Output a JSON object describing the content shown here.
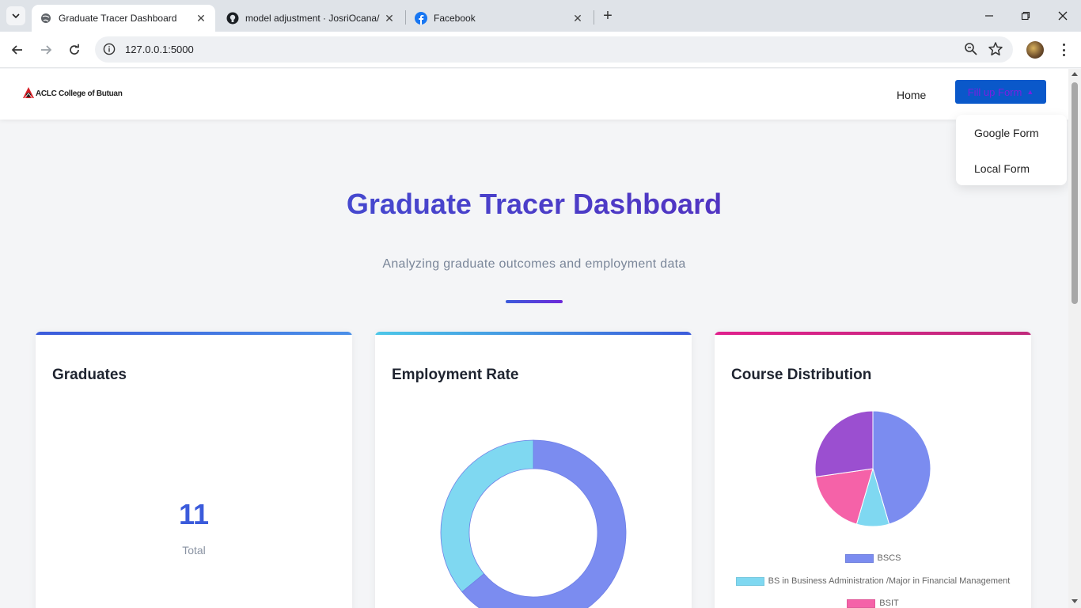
{
  "browser": {
    "tabs": [
      {
        "title": "Graduate Tracer Dashboard",
        "icon": "globe-icon"
      },
      {
        "title": "model adjustment · JosriOcana/",
        "icon": "github-icon"
      },
      {
        "title": "Facebook",
        "icon": "facebook-icon"
      }
    ],
    "url": "127.0.0.1:5000"
  },
  "nav": {
    "brand": "ACLC College of Butuan",
    "home": "Home",
    "fill_button": "Fill up Form",
    "dropdown": [
      "Google Form",
      "Local Form"
    ]
  },
  "hero": {
    "title": "Graduate Tracer Dashboard",
    "subtitle": "Analyzing graduate outcomes and employment data"
  },
  "cards": {
    "graduates": {
      "title": "Graduates",
      "value": "11",
      "label": "Total"
    },
    "employment": {
      "title": "Employment Rate"
    },
    "courses": {
      "title": "Course Distribution"
    }
  },
  "colors": {
    "primary": "#3b5bdb",
    "purple": "#5b21b6",
    "cyan": "#7fd8f1",
    "pink": "#f562a8",
    "violet": "#9b4fd0",
    "periwinkle": "#7b8cf0"
  },
  "chart_data": [
    {
      "type": "pie",
      "variant": "doughnut",
      "title": "Employment Rate",
      "slices": [
        {
          "value": 64,
          "color": "#7b8cf0"
        },
        {
          "value": 36,
          "color": "#7fd8f1"
        }
      ]
    },
    {
      "type": "pie",
      "title": "Course Distribution",
      "legend_position": "bottom",
      "slices": [
        {
          "label": "BSCS",
          "value": 5,
          "color": "#7b8cf0"
        },
        {
          "label": "BS in Business Administration / Major in Financial Management",
          "value": 1,
          "color": "#7fd8f1"
        },
        {
          "label": "BSIT",
          "value": 2,
          "color": "#f562a8"
        },
        {
          "label": "",
          "value": 3,
          "color": "#9b4fd0"
        }
      ],
      "legend_visible": [
        "BSCS",
        "BS in Business Administration /Major in Financial Management",
        "BSIT"
      ]
    }
  ]
}
